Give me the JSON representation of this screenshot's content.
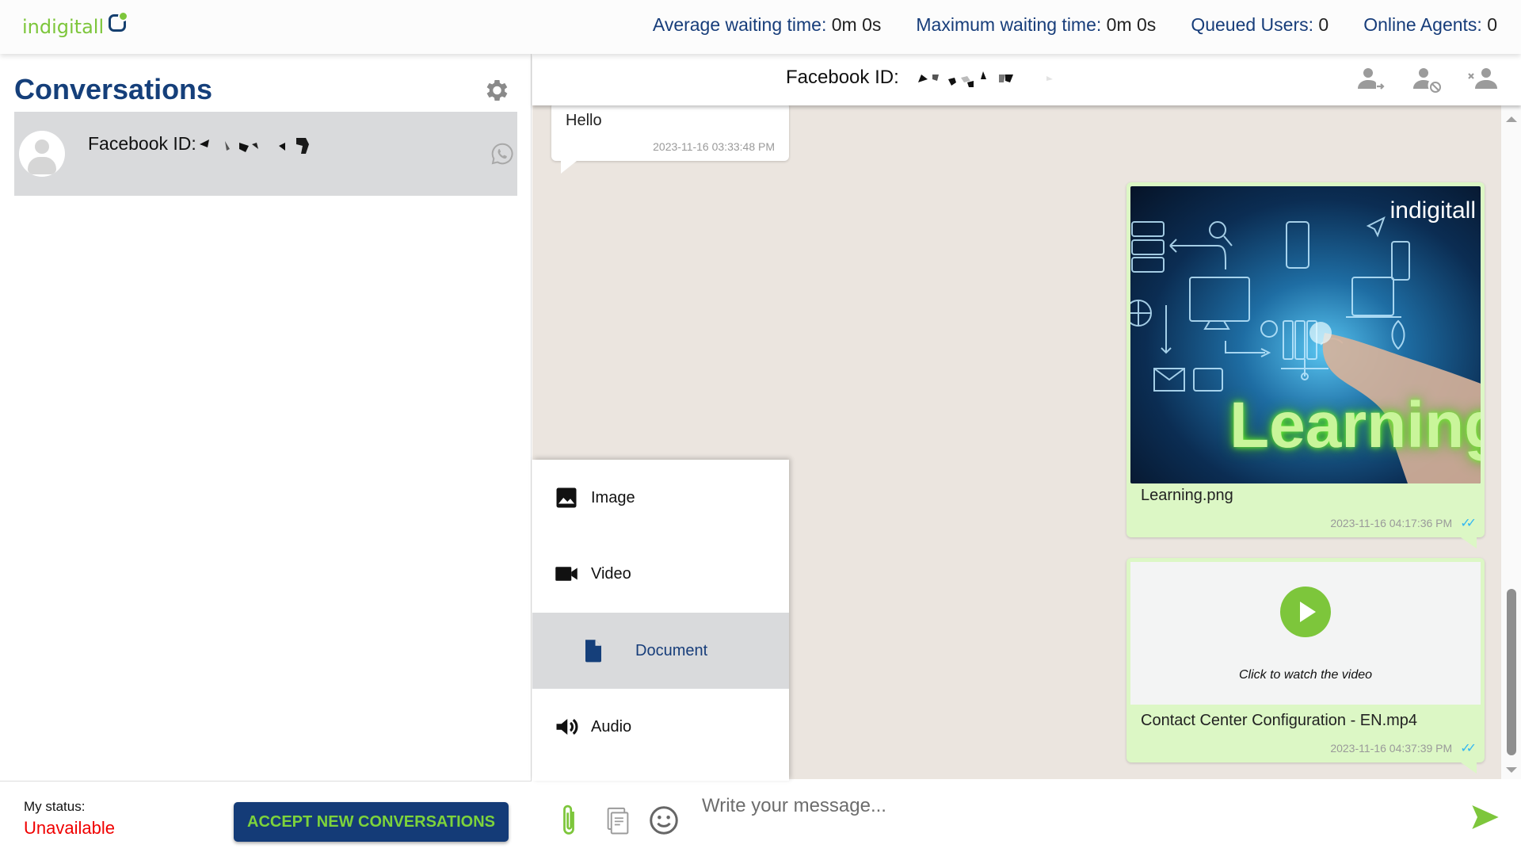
{
  "header": {
    "logo_text": "indigitall",
    "stats": [
      {
        "label": "Average waiting time:",
        "value": "0m 0s"
      },
      {
        "label": "Maximum waiting time:",
        "value": "0m 0s"
      },
      {
        "label": "Queued Users:",
        "value": "0"
      },
      {
        "label": "Online Agents:",
        "value": "0"
      }
    ]
  },
  "sidebar": {
    "title": "Conversations",
    "settings_icon": "gear-icon",
    "conversations": [
      {
        "name": "Facebook ID:",
        "channel_icon": "whatsapp-icon",
        "selected": true
      }
    ],
    "footer": {
      "status_label": "My status:",
      "status_value": "Unavailable",
      "status_color": "#f00000",
      "accept_button": "ACCEPT NEW CONVERSATIONS"
    }
  },
  "chat": {
    "header_title": "Facebook ID:",
    "header_actions": [
      "transfer-user-icon",
      "block-user-icon",
      "close-user-icon"
    ],
    "messages": [
      {
        "direction": "incoming",
        "type": "text",
        "text": "Hello",
        "time": "2023-11-16 03:33:48 PM"
      },
      {
        "direction": "outgoing",
        "type": "image",
        "image_brand": "indigitall",
        "image_word": "Learning",
        "filename": "Learning.png",
        "time": "2023-11-16 04:17:36 PM",
        "status": "read"
      },
      {
        "direction": "outgoing",
        "type": "video",
        "caption": "Click to watch the video",
        "filename": "Contact Center Configuration - EN.mp4",
        "time": "2023-11-16 04:37:39 PM",
        "status": "read"
      }
    ],
    "attach_menu": {
      "items": [
        {
          "label": "Image",
          "icon": "image-icon"
        },
        {
          "label": "Video",
          "icon": "video-camera-icon"
        },
        {
          "label": "Document",
          "icon": "document-icon",
          "highlighted": true
        },
        {
          "label": "Audio",
          "icon": "speaker-icon"
        }
      ]
    },
    "composer": {
      "placeholder": "Write your message...",
      "value": ""
    }
  },
  "colors": {
    "brand_green": "#7dc63b",
    "brand_navy": "#143b77",
    "chat_bg": "#ebe5df",
    "outgoing_bubble": "#dcf7c5",
    "read_tick": "#34b7f1"
  }
}
